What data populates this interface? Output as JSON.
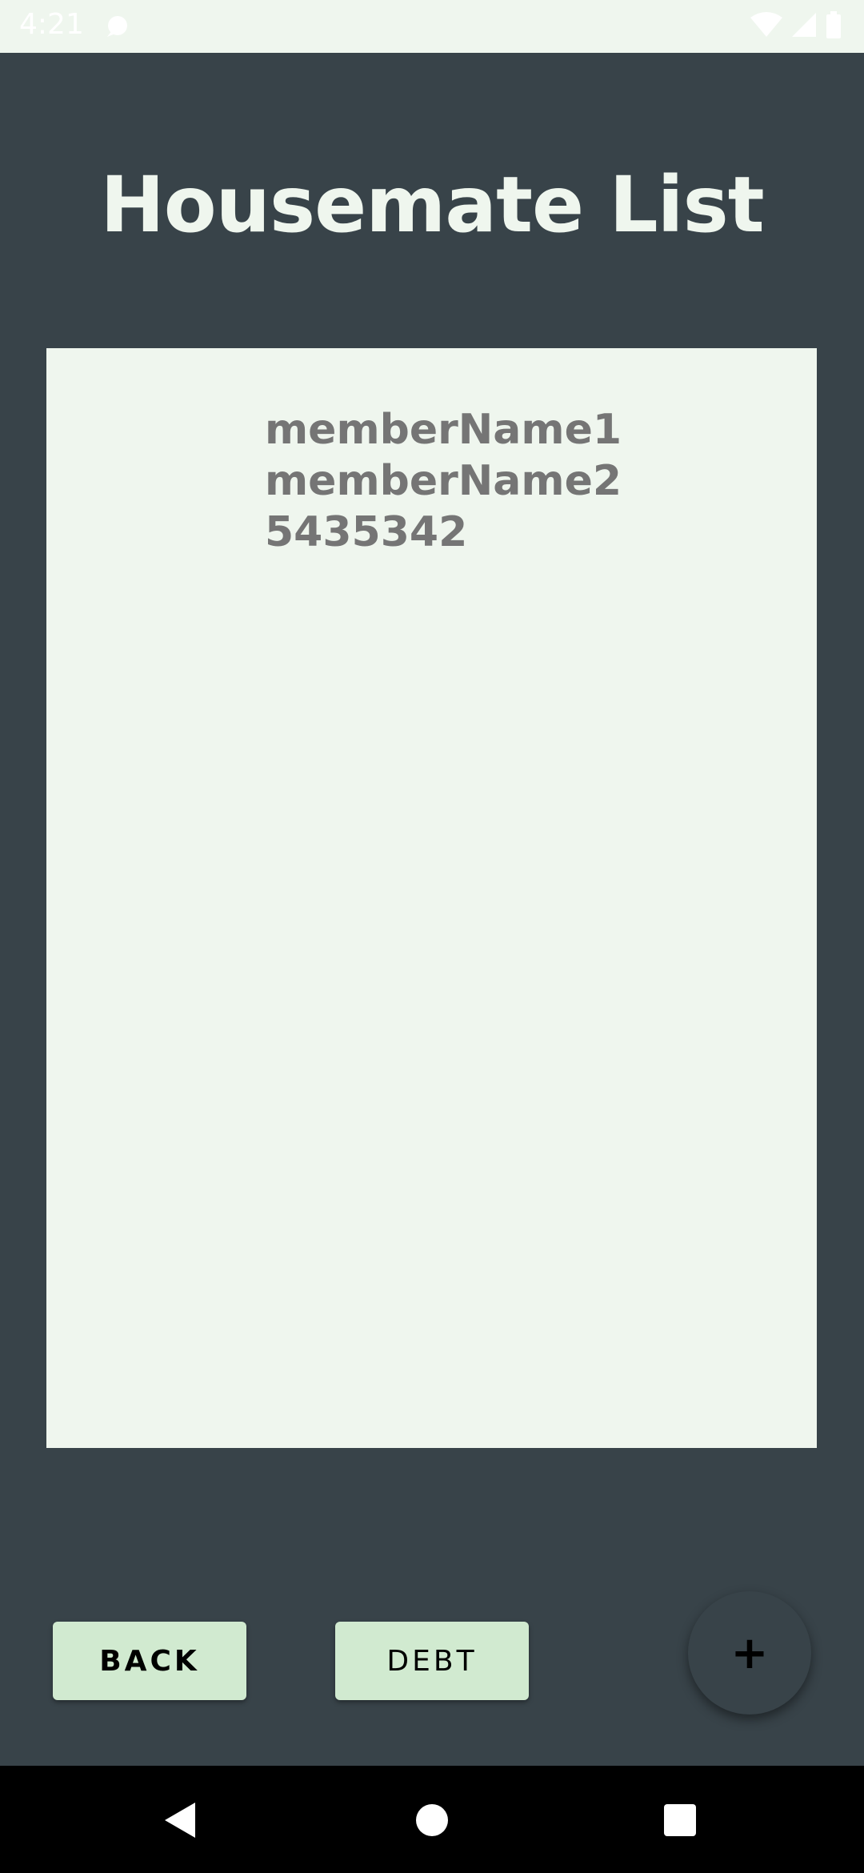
{
  "status_bar": {
    "time": "4:21",
    "icons": [
      "notification-icon",
      "wifi-icon",
      "signal-icon",
      "battery-icon"
    ]
  },
  "page": {
    "title": "Housemate List"
  },
  "list": {
    "items": [
      {
        "line1": "memberName1",
        "line2": "memberName2",
        "line3": "5435342"
      }
    ]
  },
  "buttons": {
    "back_label": "BACK",
    "debt_label": "DEBT",
    "add_label": "+"
  },
  "colors": {
    "background": "#384349",
    "panel": "#eff6ee",
    "button": "#d1ead0",
    "list_text": "#757575"
  }
}
